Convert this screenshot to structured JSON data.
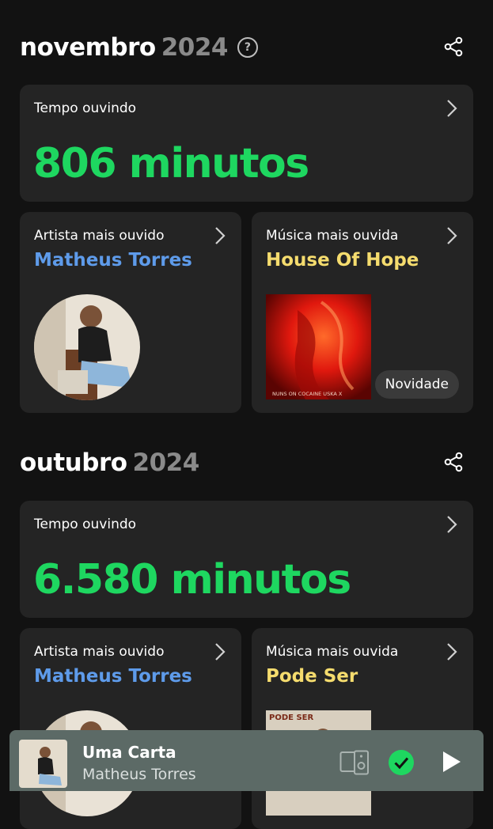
{
  "colors": {
    "background": "#121212",
    "card": "#242424",
    "green": "#1ed760",
    "artist_blue": "#5e9bea",
    "song_yellow": "#f5dc6e",
    "player_bg": "#5c6a66"
  },
  "months": [
    {
      "name": "novembro",
      "year": "2024",
      "help_icon": "question-circle-icon",
      "share_icon": "share-icon",
      "listening": {
        "label": "Tempo ouvindo",
        "value": "806 minutos"
      },
      "top_artist": {
        "label": "Artista mais ouvido",
        "name": "Matheus Torres"
      },
      "top_song": {
        "label": "Música mais ouvida",
        "title": "House Of Hope",
        "badge": "Novidade",
        "cover_text": "NUNS ON COCAINE   USKA X"
      }
    },
    {
      "name": "outubro",
      "year": "2024",
      "share_icon": "share-icon",
      "listening": {
        "label": "Tempo ouvindo",
        "value": "6.580 minutos"
      },
      "top_artist": {
        "label": "Artista mais ouvido",
        "name": "Matheus Torres"
      },
      "top_song": {
        "label": "Música mais ouvida",
        "title": "Pode Ser",
        "cover_text": "PODE SER"
      }
    }
  ],
  "now_playing": {
    "title": "Uma Carta",
    "artist": "Matheus Torres",
    "icons": [
      "devices-icon",
      "saved-check-icon",
      "play-icon"
    ]
  }
}
